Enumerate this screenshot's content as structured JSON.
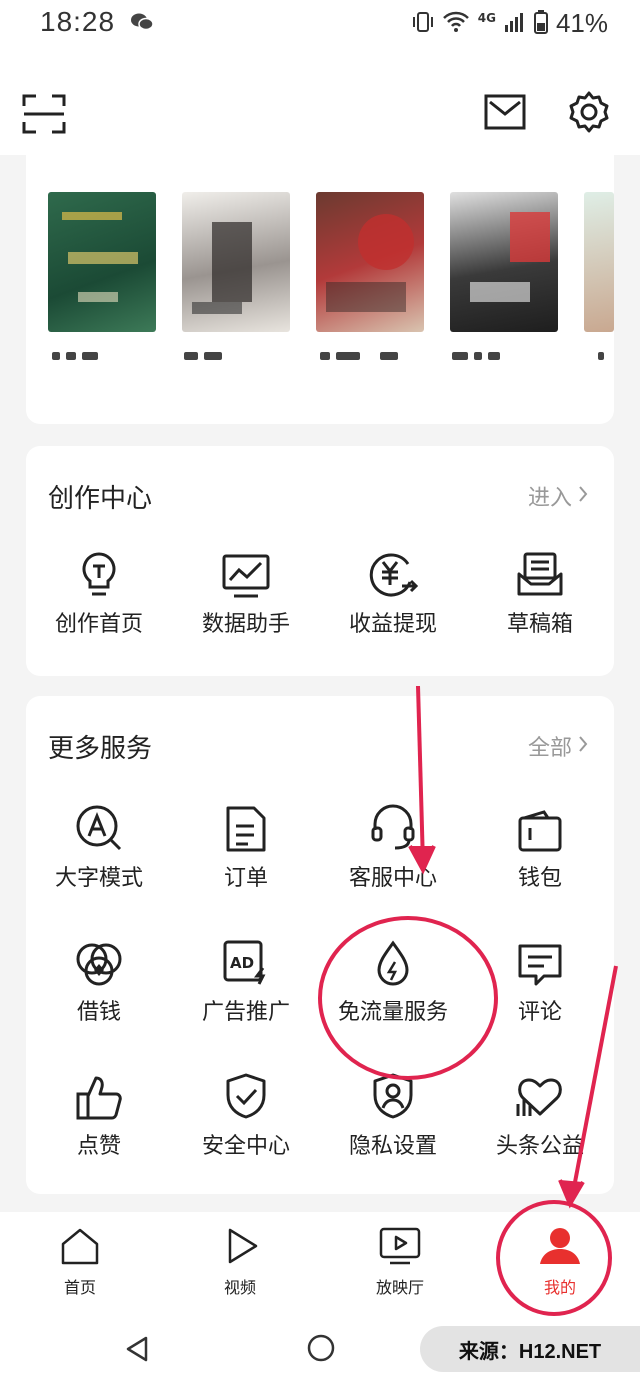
{
  "status": {
    "time": "18:28",
    "network": "4G",
    "battery": "41%"
  },
  "creator": {
    "title": "创作中心",
    "more": "进入",
    "items": [
      {
        "label": "创作首页",
        "icon": "bulb-icon"
      },
      {
        "label": "数据助手",
        "icon": "chart-monitor-icon"
      },
      {
        "label": "收益提现",
        "icon": "yuan-withdraw-icon"
      },
      {
        "label": "草稿箱",
        "icon": "draft-box-icon"
      }
    ]
  },
  "services": {
    "title": "更多服务",
    "more": "全部",
    "items": [
      {
        "label": "大字模式",
        "icon": "large-font-icon"
      },
      {
        "label": "订单",
        "icon": "order-icon"
      },
      {
        "label": "客服中心",
        "icon": "headset-icon"
      },
      {
        "label": "钱包",
        "icon": "wallet-icon"
      },
      {
        "label": "借钱",
        "icon": "loan-icon"
      },
      {
        "label": "广告推广",
        "icon": "ad-icon"
      },
      {
        "label": "免流量服务",
        "icon": "drop-icon"
      },
      {
        "label": "评论",
        "icon": "comment-icon"
      },
      {
        "label": "点赞",
        "icon": "thumbs-up-icon"
      },
      {
        "label": "安全中心",
        "icon": "shield-check-icon"
      },
      {
        "label": "隐私设置",
        "icon": "privacy-icon"
      },
      {
        "label": "头条公益",
        "icon": "charity-icon"
      }
    ]
  },
  "tabs": [
    {
      "label": "首页",
      "icon": "home-icon"
    },
    {
      "label": "视频",
      "icon": "play-icon"
    },
    {
      "label": "放映厅",
      "icon": "tv-icon"
    },
    {
      "label": "我的",
      "icon": "user-icon",
      "active": true
    }
  ],
  "watermark": "来源：H12.NET",
  "colors": {
    "accent": "#e8302e",
    "annotation": "#e0244f"
  }
}
